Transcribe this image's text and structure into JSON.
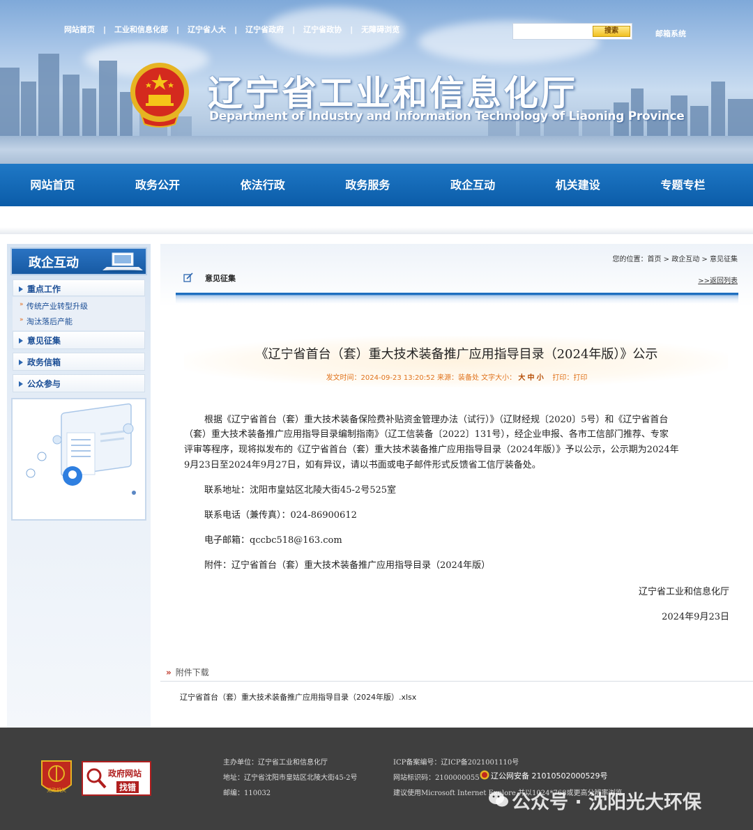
{
  "top_links": [
    "网站首页",
    "工业和信息化部",
    "辽宁省人大",
    "辽宁省政府",
    "辽宁省政协",
    "无障碍浏览"
  ],
  "search": {
    "placeholder": "",
    "button_label": "搜索"
  },
  "mail_link": "邮箱系统",
  "site": {
    "title": "辽宁省工业和信息化厅",
    "subtitle": "Department of Industry and Information Technology of Liaoning Province"
  },
  "nav": [
    "网站首页",
    "政务公开",
    "依法行政",
    "政务服务",
    "政企互动",
    "机关建设",
    "专题专栏"
  ],
  "sidebar": {
    "title": "政企互动",
    "head_item": "重点工作",
    "sub_items": [
      "传统产业转型升级",
      "淘汰落后产能"
    ],
    "items": [
      "意见征集",
      "政务信箱",
      "公众参与"
    ]
  },
  "breadcrumb": {
    "prefix": "您的位置：",
    "home": "首页",
    "sep": " > ",
    "level1": "政企互动",
    "level2": "意见征集"
  },
  "section": {
    "title": "意见征集",
    "back_link": ">>返回列表"
  },
  "article": {
    "title": "《辽宁省首台（套）重大技术装备推广应用指导目录（2024年版）》公示",
    "meta_prefix": "发文时间：2024-09-23 13:20:52  来源：装备处  文字大小：",
    "size_large": "大",
    "size_medium": "中",
    "size_small": "小",
    "print_label": "打印：",
    "print_link": "打印",
    "body_line1": "根据《辽宁省首台（套）重大技术装备保险费补贴资金管理办法（试行）》（辽财经规〔2020〕5号）和《辽宁省首台",
    "body_line2": "（套）重大技术装备推广应用指导目录编制指南》（辽工信装备〔2022〕131号），经企业申报、各市工信部门推荐、专家",
    "body_line3": "评审等程序，现将拟发布的《辽宁省首台（套）重大技术装备推广应用指导目录（2024年版）》予以公示，公示期为2024年",
    "body_line4": "9月23日至2024年9月27日，如有异议，请以书面或电子邮件形式反馈省工信厅装备处。",
    "address": "联系地址：沈阳市皇姑区北陵大街45-2号525室",
    "phone": "联系电话（兼传真）：024-86900612",
    "email": "电子邮箱：qccbc518@163.com",
    "attachment": "附件：辽宁省首台（套）重大技术装备推广应用指导目录（2024年版）",
    "signature": "辽宁省工业和信息化厅",
    "date": "2024年9月23日"
  },
  "attachments": {
    "header": "附件下载",
    "file": "辽宁省首台（套）重大技术装备推广应用指导目录（2024年版）.xlsx"
  },
  "footer": {
    "sponsor": "主办单位：辽宁省工业和信息化厅",
    "address": "地址：辽宁省沈阳市皇姑区北陵大街45-2号",
    "postcode": "邮编：110032",
    "icp": "ICP备案编号：辽ICP备2021001110号",
    "site_id": "网站标识码：2100000055",
    "police": "辽公网安备 21010502000529号",
    "browser_tip": "建议使用Microsoft Internet Explore 并以1024*768或更高分辨率浏览",
    "badge_gov_label": "政府网站",
    "badge_gov_sub": "找错",
    "badge_party_label": "党政机关"
  },
  "watermark": "公众号 · 沈阳光大环保",
  "colors": {
    "nav_blue": "#1466b4",
    "footer_bg": "#3f3f3f",
    "meta_orange": "#e0731c"
  }
}
